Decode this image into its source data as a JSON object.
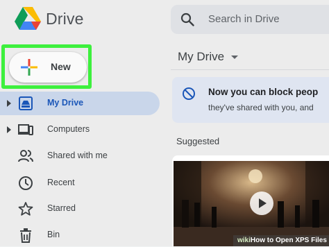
{
  "app": {
    "brand": "Drive"
  },
  "search": {
    "placeholder": "Search in Drive"
  },
  "new_button": {
    "label": "New"
  },
  "sidebar": {
    "items": [
      {
        "label": "My Drive",
        "icon": "my-drive-icon",
        "active": true,
        "expandable": true
      },
      {
        "label": "Computers",
        "icon": "computers-icon",
        "active": false,
        "expandable": true
      },
      {
        "label": "Shared with me",
        "icon": "shared-with-me-icon",
        "active": false,
        "expandable": false
      },
      {
        "label": "Recent",
        "icon": "clock-icon",
        "active": false,
        "expandable": false
      },
      {
        "label": "Starred",
        "icon": "star-icon",
        "active": false,
        "expandable": false
      },
      {
        "label": "Bin",
        "icon": "bin-icon",
        "active": false,
        "expandable": false
      }
    ]
  },
  "main": {
    "title": "My Drive",
    "banner": {
      "line1": "Now you can block peop",
      "line2": "they've shared with you, and"
    },
    "suggested_label": "Suggested"
  },
  "watermark": {
    "prefix": "wiki",
    "text": "How to Open XPS Files"
  },
  "colors": {
    "highlight": "#3df03d",
    "active_nav_bg": "#c9d6ea",
    "active_nav_text": "#1a56b8",
    "banner_bg": "#dfe5f1"
  }
}
